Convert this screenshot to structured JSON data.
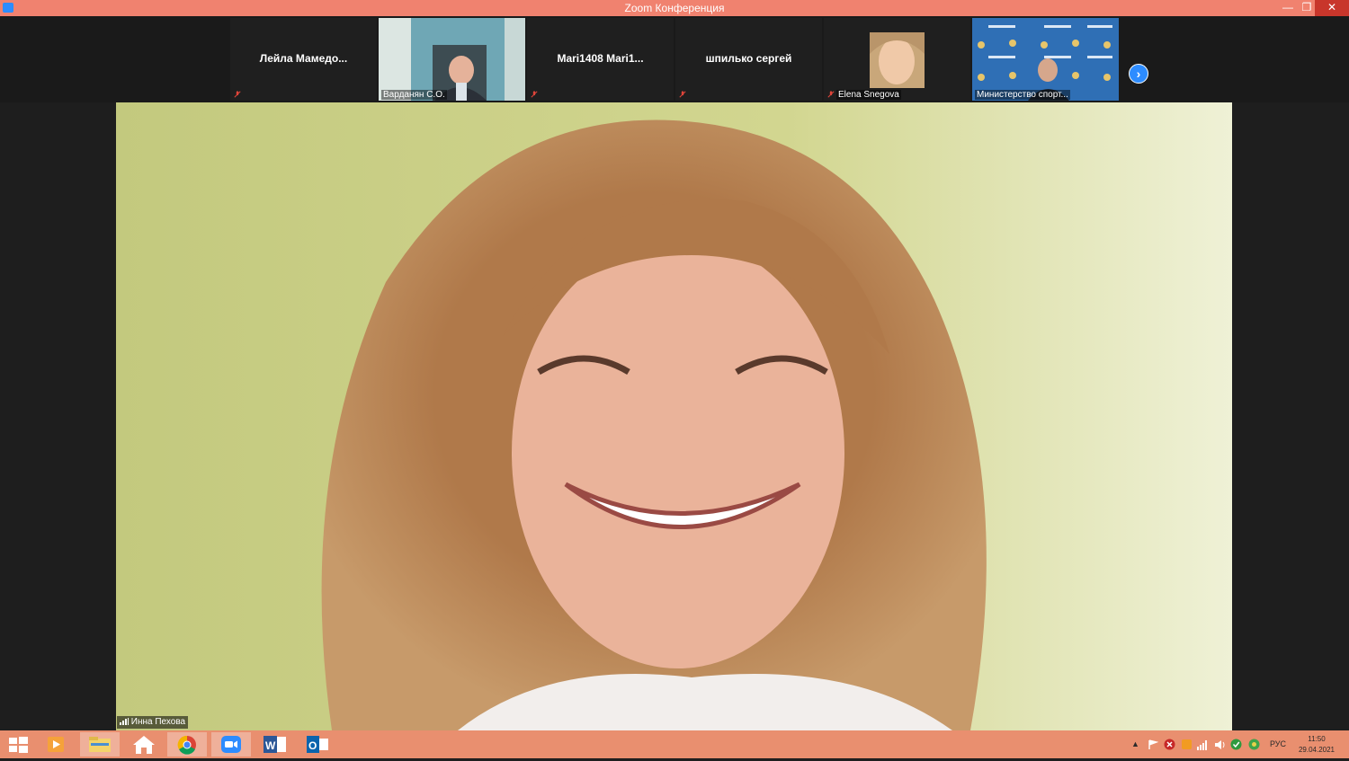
{
  "window": {
    "title": "Zoom Конференция"
  },
  "participants": [
    {
      "name": "Лейла  Мамедо...",
      "label": "",
      "video": false,
      "muted": true
    },
    {
      "name": "",
      "label": "Варданян С.О.",
      "video": true,
      "muted": false
    },
    {
      "name": "Mari1408  Mari1...",
      "label": "",
      "video": false,
      "muted": true
    },
    {
      "name": "шпилько сергей",
      "label": "",
      "video": false,
      "muted": true
    },
    {
      "name": "",
      "label": "Elena Snegova",
      "video": true,
      "muted": true
    },
    {
      "name": "",
      "label": "Министерство спорт...",
      "video": true,
      "muted": false
    }
  ],
  "active_speaker": {
    "label": "Инна Пехова"
  },
  "taskbar": {
    "apps": [
      "windows-start",
      "media-player",
      "file-explorer",
      "home",
      "chrome",
      "zoom",
      "word",
      "outlook"
    ],
    "language": "РУС",
    "time": "11:50",
    "date": "29.04.2021"
  },
  "colors": {
    "titlebar": "#f0826f",
    "taskbar": "#e98f6f",
    "zoom_blue": "#2d8cff"
  }
}
